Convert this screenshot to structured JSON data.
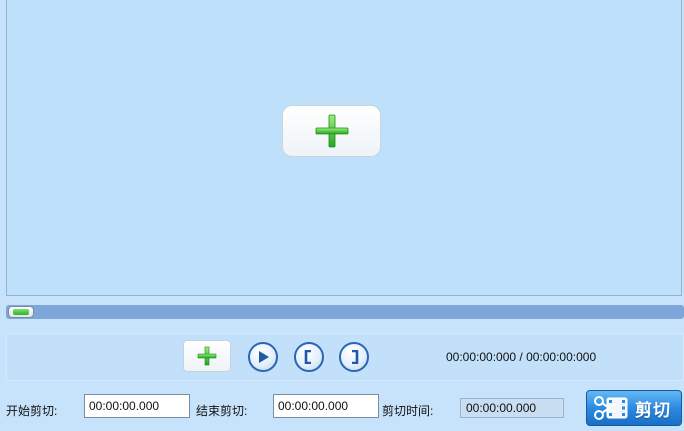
{
  "player": {
    "add_icon": "plus-icon",
    "colors": {
      "accent_green": "#35b52b",
      "border_blue": "#2a66b3",
      "cut_button": "#2c8ae0"
    }
  },
  "controls": {
    "buttons": [
      {
        "name": "add-file-button",
        "icon": "plus-icon"
      },
      {
        "name": "play-button",
        "icon": "play-icon"
      },
      {
        "name": "set-start-button",
        "icon": "bracket-left-icon"
      },
      {
        "name": "set-end-button",
        "icon": "bracket-right-icon"
      }
    ],
    "time_display": "00:00:00:000 / 00:00:00:000"
  },
  "cut_form": {
    "start_label": "开始剪切:",
    "start_value": "00:00:00.000",
    "end_label": "结束剪切:",
    "end_value": "00:00:00.000",
    "duration_label": "剪切时间:",
    "duration_value": "00:00:00.000",
    "cut_button_label": "剪切",
    "cut_button_icon": "scissors-film-icon"
  }
}
